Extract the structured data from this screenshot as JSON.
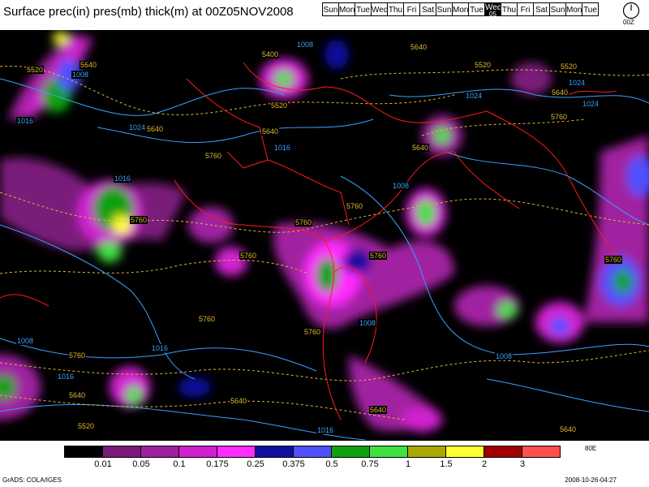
{
  "title": "Surface prec(in) pres(mb) thick(m) at 00Z05NOV2008",
  "days": [
    {
      "label": "Sun"
    },
    {
      "label": "Mon"
    },
    {
      "label": "Tue"
    },
    {
      "label": "Wed"
    },
    {
      "label": "Thu"
    },
    {
      "label": "Fri"
    },
    {
      "label": "Sat"
    },
    {
      "label": "Sun"
    },
    {
      "label": "Mon"
    },
    {
      "label": "Tue"
    },
    {
      "label": "Wed",
      "num": "05",
      "current": true
    },
    {
      "label": "Thu"
    },
    {
      "label": "Fri"
    },
    {
      "label": "Sat"
    },
    {
      "label": "Sun"
    },
    {
      "label": "Mon"
    },
    {
      "label": "Tue"
    }
  ],
  "clock_label": "00Z",
  "legend": {
    "colors": [
      "#000000",
      "#7a1a7a",
      "#a020a0",
      "#d020d0",
      "#ff2cff",
      "#1010a0",
      "#5050ff",
      "#10a010",
      "#40e040",
      "#a8a800",
      "#ffff30",
      "#a00000",
      "#ff5050"
    ],
    "ticks": [
      "0.01",
      "0.05",
      "0.1",
      "0.175",
      "0.25",
      "0.375",
      "0.5",
      "0.75",
      "1",
      "1.5",
      "2",
      "3"
    ],
    "trailing": "80E"
  },
  "contour_labels": [
    {
      "text": "1024",
      "kind": "pres"
    },
    {
      "text": "1008",
      "kind": "pres"
    },
    {
      "text": "1008",
      "kind": "pres"
    },
    {
      "text": "1024",
      "kind": "pres"
    },
    {
      "text": "1016",
      "kind": "pres"
    },
    {
      "text": "1016",
      "kind": "pres"
    },
    {
      "text": "1016",
      "kind": "pres"
    },
    {
      "text": "1008",
      "kind": "pres"
    },
    {
      "text": "1024",
      "kind": "pres"
    },
    {
      "text": "1024",
      "kind": "pres"
    },
    {
      "text": "1024",
      "kind": "pres"
    },
    {
      "text": "1008",
      "kind": "pres"
    },
    {
      "text": "1008",
      "kind": "pres"
    },
    {
      "text": "1008",
      "kind": "pres"
    },
    {
      "text": "1016",
      "kind": "pres"
    },
    {
      "text": "1016",
      "kind": "pres"
    },
    {
      "text": "1016",
      "kind": "pres"
    },
    {
      "text": "5520",
      "kind": "thick"
    },
    {
      "text": "5640",
      "kind": "thick"
    },
    {
      "text": "5400",
      "kind": "thick"
    },
    {
      "text": "5640",
      "kind": "thick"
    },
    {
      "text": "5520",
      "kind": "thick"
    },
    {
      "text": "5640",
      "kind": "thick"
    },
    {
      "text": "5520",
      "kind": "thick"
    },
    {
      "text": "5640",
      "kind": "thick"
    },
    {
      "text": "5520",
      "kind": "thick"
    },
    {
      "text": "5640",
      "kind": "thick"
    },
    {
      "text": "5760",
      "kind": "thick"
    },
    {
      "text": "5640",
      "kind": "thick"
    },
    {
      "text": "5760",
      "kind": "thick"
    },
    {
      "text": "5760",
      "kind": "thick"
    },
    {
      "text": "5760",
      "kind": "thick"
    },
    {
      "text": "5760",
      "kind": "thick"
    },
    {
      "text": "5760",
      "kind": "thick"
    },
    {
      "text": "5760",
      "kind": "thick"
    },
    {
      "text": "5760",
      "kind": "thick"
    },
    {
      "text": "5760",
      "kind": "thick"
    },
    {
      "text": "5760",
      "kind": "thick"
    },
    {
      "text": "5760",
      "kind": "thick"
    },
    {
      "text": "5640",
      "kind": "thick"
    },
    {
      "text": "5640",
      "kind": "thick"
    },
    {
      "text": "5640",
      "kind": "thick"
    },
    {
      "text": "5640",
      "kind": "thick"
    },
    {
      "text": "5520",
      "kind": "thick"
    }
  ],
  "footer_left": "GrADS: COLA/IGES",
  "footer_right": "2008-10-26-04:27"
}
